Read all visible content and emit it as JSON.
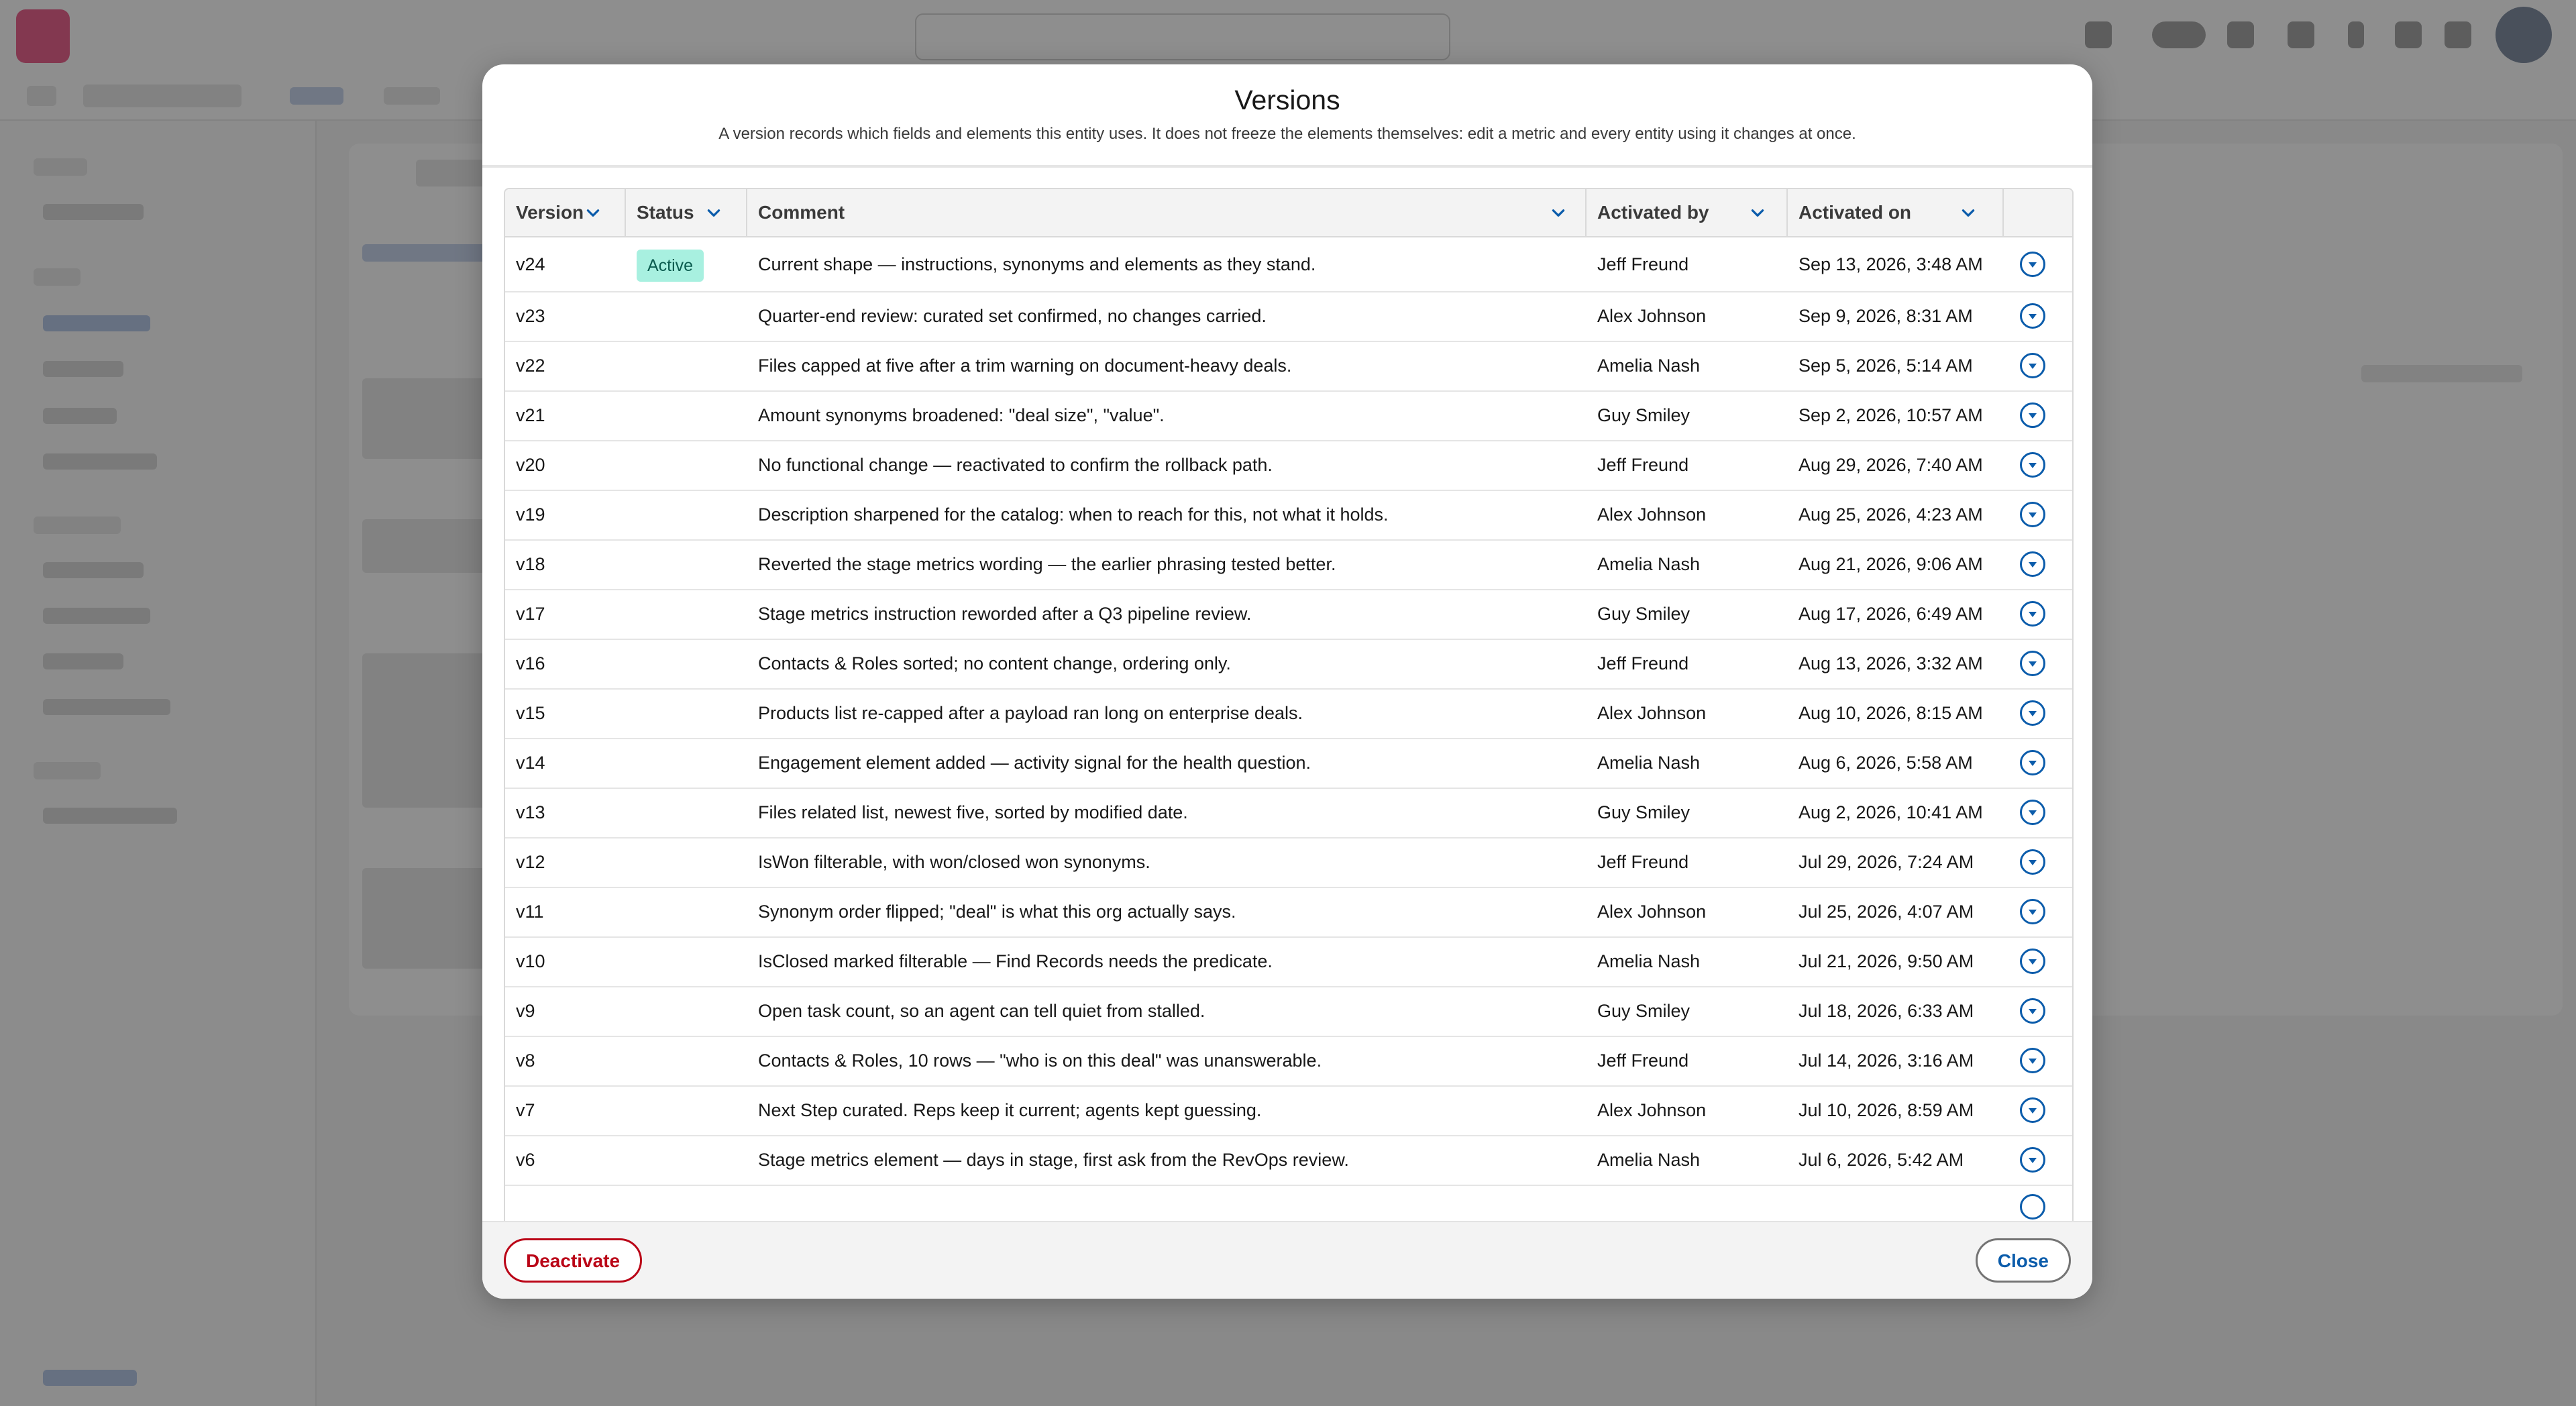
{
  "modal": {
    "title": "Versions",
    "subtitle": "A version records which fields and elements this entity uses. It does not freeze the elements themselves: edit a metric and every entity using it changes at once."
  },
  "table": {
    "columns": [
      "Version",
      "Status",
      "Comment",
      "Activated by",
      "Activated on"
    ],
    "rows": [
      {
        "version": "v24",
        "status": "Active",
        "comment": "Current shape — instructions, synonyms and elements as they stand.",
        "activated_by": "Jeff Freund",
        "activated_on": "Sep 13, 2026, 3:48 AM"
      },
      {
        "version": "v23",
        "status": "",
        "comment": "Quarter-end review: curated set confirmed, no changes carried.",
        "activated_by": "Alex Johnson",
        "activated_on": "Sep 9, 2026, 8:31 AM"
      },
      {
        "version": "v22",
        "status": "",
        "comment": "Files capped at five after a trim warning on document-heavy deals.",
        "activated_by": "Amelia Nash",
        "activated_on": "Sep 5, 2026, 5:14 AM"
      },
      {
        "version": "v21",
        "status": "",
        "comment": "Amount synonyms broadened: \"deal size\", \"value\".",
        "activated_by": "Guy Smiley",
        "activated_on": "Sep 2, 2026, 10:57 AM"
      },
      {
        "version": "v20",
        "status": "",
        "comment": "No functional change — reactivated to confirm the rollback path.",
        "activated_by": "Jeff Freund",
        "activated_on": "Aug 29, 2026, 7:40 AM"
      },
      {
        "version": "v19",
        "status": "",
        "comment": "Description sharpened for the catalog: when to reach for this, not what it holds.",
        "activated_by": "Alex Johnson",
        "activated_on": "Aug 25, 2026, 4:23 AM"
      },
      {
        "version": "v18",
        "status": "",
        "comment": "Reverted the stage metrics wording — the earlier phrasing tested better.",
        "activated_by": "Amelia Nash",
        "activated_on": "Aug 21, 2026, 9:06 AM"
      },
      {
        "version": "v17",
        "status": "",
        "comment": "Stage metrics instruction reworded after a Q3 pipeline review.",
        "activated_by": "Guy Smiley",
        "activated_on": "Aug 17, 2026, 6:49 AM"
      },
      {
        "version": "v16",
        "status": "",
        "comment": "Contacts & Roles sorted; no content change, ordering only.",
        "activated_by": "Jeff Freund",
        "activated_on": "Aug 13, 2026, 3:32 AM"
      },
      {
        "version": "v15",
        "status": "",
        "comment": "Products list re-capped after a payload ran long on enterprise deals.",
        "activated_by": "Alex Johnson",
        "activated_on": "Aug 10, 2026, 8:15 AM"
      },
      {
        "version": "v14",
        "status": "",
        "comment": "Engagement element added — activity signal for the health question.",
        "activated_by": "Amelia Nash",
        "activated_on": "Aug 6, 2026, 5:58 AM"
      },
      {
        "version": "v13",
        "status": "",
        "comment": "Files related list, newest five, sorted by modified date.",
        "activated_by": "Guy Smiley",
        "activated_on": "Aug 2, 2026, 10:41 AM"
      },
      {
        "version": "v12",
        "status": "",
        "comment": "IsWon filterable, with won/closed won synonyms.",
        "activated_by": "Jeff Freund",
        "activated_on": "Jul 29, 2026, 7:24 AM"
      },
      {
        "version": "v11",
        "status": "",
        "comment": "Synonym order flipped; \"deal\" is what this org actually says.",
        "activated_by": "Alex Johnson",
        "activated_on": "Jul 25, 2026, 4:07 AM"
      },
      {
        "version": "v10",
        "status": "",
        "comment": "IsClosed marked filterable — Find Records needs the predicate.",
        "activated_by": "Amelia Nash",
        "activated_on": "Jul 21, 2026, 9:50 AM"
      },
      {
        "version": "v9",
        "status": "",
        "comment": "Open task count, so an agent can tell quiet from stalled.",
        "activated_by": "Guy Smiley",
        "activated_on": "Jul 18, 2026, 6:33 AM"
      },
      {
        "version": "v8",
        "status": "",
        "comment": "Contacts & Roles, 10 rows — \"who is on this deal\" was unanswerable.",
        "activated_by": "Jeff Freund",
        "activated_on": "Jul 14, 2026, 3:16 AM"
      },
      {
        "version": "v7",
        "status": "",
        "comment": "Next Step curated. Reps keep it current; agents kept guessing.",
        "activated_by": "Alex Johnson",
        "activated_on": "Jul 10, 2026, 8:59 AM"
      },
      {
        "version": "v6",
        "status": "",
        "comment": "Stage metrics element — days in stage, first ask from the RevOps review.",
        "activated_by": "Amelia Nash",
        "activated_on": "Jul 6, 2026, 5:42 AM"
      }
    ]
  },
  "footer": {
    "deactivate_label": "Deactivate",
    "close_label": "Close"
  },
  "icons": {
    "column_sort": "chevron-down-icon",
    "row_action": "row-actions-dropdown-icon"
  },
  "colors": {
    "active_badge_bg": "#a8f0e0",
    "brand_blue": "#0b5cab",
    "destructive_red": "#ba0517"
  }
}
